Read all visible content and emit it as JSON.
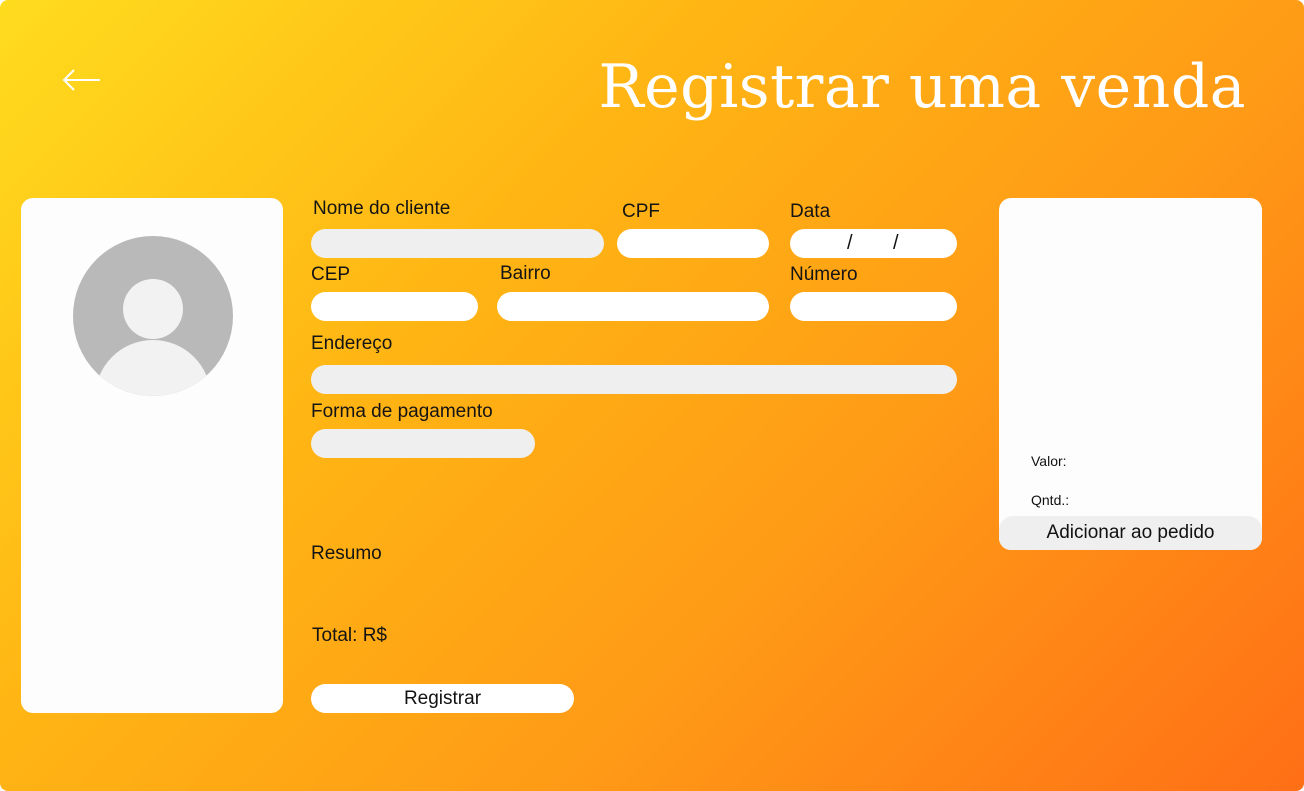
{
  "header": {
    "back_icon": "arrow-left-icon",
    "title": "Registrar uma venda"
  },
  "colors": {
    "gradient_start": "#ffdc1e",
    "gradient_end": "#ff6f16",
    "field_gray": "#efefef",
    "panel_white": "#fdfdfd"
  },
  "avatar": {
    "icon": "user-avatar-icon"
  },
  "form": {
    "nome_label": "Nome do cliente",
    "nome_value": "",
    "cpf_label": "CPF",
    "cpf_value": "",
    "data_label": "Data",
    "data_sep_1": "/",
    "data_sep_2": "/",
    "cep_label": "CEP",
    "cep_value": "",
    "bairro_label": "Bairro",
    "bairro_value": "",
    "numero_label": "Número",
    "numero_value": "",
    "endereco_label": "Endereço",
    "endereco_value": "",
    "pagamento_label": "Forma de pagamento",
    "pagamento_value": ""
  },
  "summary": {
    "resumo_label": "Resumo",
    "total_label": "Total: R$"
  },
  "actions": {
    "registrar_label": "Registrar"
  },
  "product": {
    "valor_label": "Valor:",
    "qntd_label": "Qntd.:",
    "add_label": "Adicionar ao pedido"
  }
}
